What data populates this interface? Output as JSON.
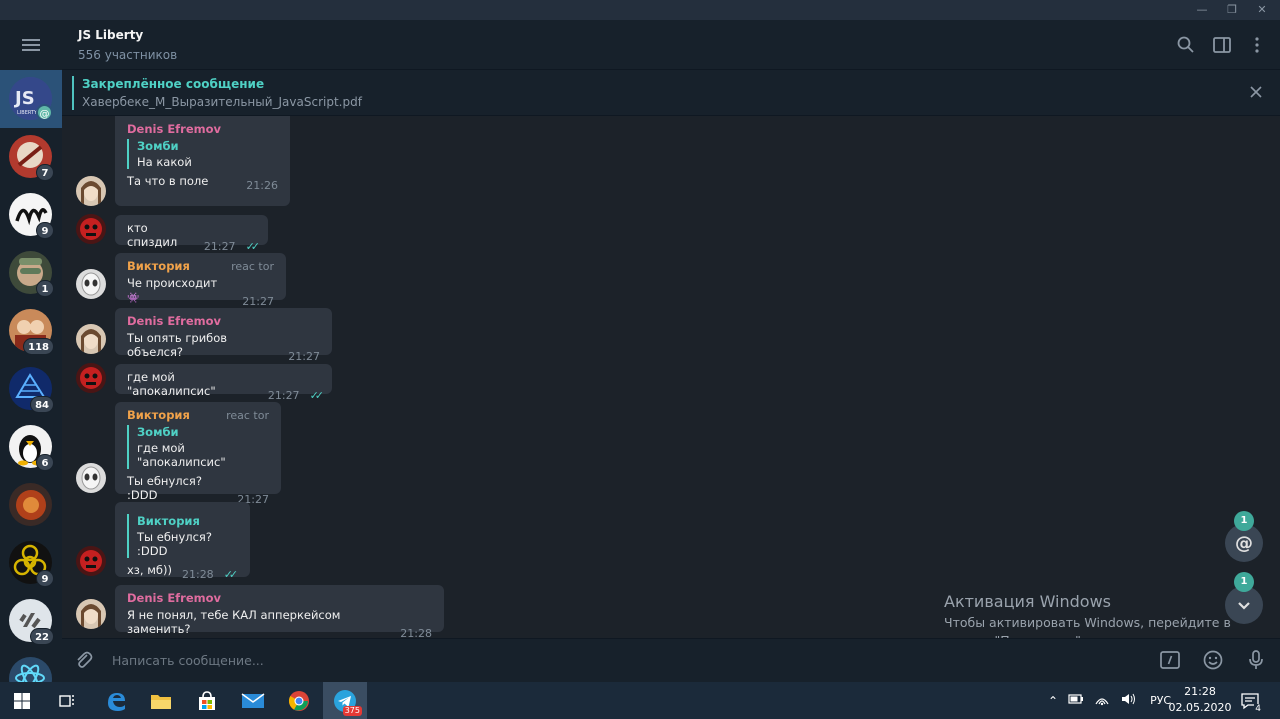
{
  "header": {
    "title": "JS Liberty",
    "subtitle": "556 участников"
  },
  "pinned": {
    "title": "Закреплённое сообщение",
    "text": "Хавербеке_М_Выразительный_JavaScript.pdf"
  },
  "chats": [
    {
      "badge": "@",
      "color": "#3a4d8c",
      "active": true
    },
    {
      "badge": "7",
      "color": "#c0392b"
    },
    {
      "badge": "9",
      "color": "#f2f2f2"
    },
    {
      "badge": "1",
      "color": "#5b6b4c"
    },
    {
      "badge": "118",
      "color": "#b96a3a"
    },
    {
      "badge": "84",
      "color": "#1f3d8a"
    },
    {
      "badge": "6",
      "color": "#e8e8e8"
    },
    {
      "badge": "",
      "color": "#8a3a20"
    },
    {
      "badge": "9",
      "color": "#d6b400"
    },
    {
      "badge": "22",
      "color": "#5c6e80"
    },
    {
      "badge": "",
      "color": "#4a9fd8"
    }
  ],
  "messages": {
    "m1": {
      "author": "Denis Efremov",
      "reply_name": "Зомби",
      "reply_text": "На какой",
      "text": "Та что в поле",
      "time": "21:26"
    },
    "m2": {
      "text": "кто спиздил",
      "time": "21:27"
    },
    "m3": {
      "author": "Виктория",
      "role": "reac tor",
      "text": "Че происходит",
      "emoji": "👾",
      "time": "21:27"
    },
    "m4": {
      "author": "Denis Efremov",
      "text": "Ты опять грибов объелся?",
      "time": "21:27"
    },
    "m5": {
      "text": "где мой \"апокалипсис\"",
      "time": "21:27"
    },
    "m6": {
      "author": "Виктория",
      "role": "reac tor",
      "reply_name": "Зомби",
      "reply_text": "где мой \"апокалипсис\"",
      "text": "Ты ебнулся? :DDD",
      "time": "21:27"
    },
    "m7": {
      "reply_name": "Виктория",
      "reply_text": "Ты ебнулся? :DDD",
      "text": "хз,  мб))",
      "time": "21:28"
    },
    "m8": {
      "author": "Denis Efremov",
      "text": "Я не понял, тебе КАЛ апперкейсом заменить?",
      "time": "21:28"
    }
  },
  "floating": {
    "mentions_count": "1",
    "down_count": "1"
  },
  "activation": {
    "title": "Активация Windows",
    "line1": "Чтобы активировать Windows, перейдите в",
    "line2": "раздел \"Параметры\"."
  },
  "compose": {
    "placeholder": "Написать сообщение..."
  },
  "taskbar": {
    "telegram_badge": "375",
    "lang": "РУС",
    "time": "21:28",
    "date": "02.05.2020",
    "notif_count": "4"
  },
  "colors": {
    "author_pink": "#e06c9f",
    "author_orange": "#f0a24a",
    "accent_teal": "#4fd1c5",
    "bubble": "#2f3640"
  }
}
